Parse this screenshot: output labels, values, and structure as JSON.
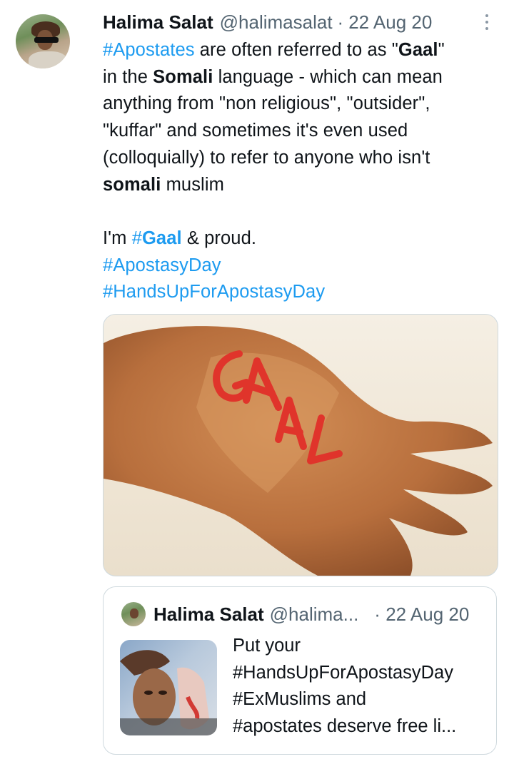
{
  "tweet": {
    "author_name": "Halima Salat",
    "author_handle": "@halimasalat",
    "separator": "·",
    "date": "22 Aug 20",
    "more_icon": "more-vertical-icon",
    "lines": [
      [
        {
          "t": "#Apostates",
          "k": "tag"
        },
        {
          "t": " are often referred to as \"",
          "k": "text"
        },
        {
          "t": "Gaal",
          "k": "bold"
        },
        {
          "t": "\"",
          "k": "text"
        }
      ],
      [
        {
          "t": "in the ",
          "k": "text"
        },
        {
          "t": "Somali",
          "k": "bold"
        },
        {
          "t": " language - which can mean",
          "k": "text"
        }
      ],
      [
        {
          "t": "anything from \"non religious\", \"outsider\",",
          "k": "text"
        }
      ],
      [
        {
          "t": "\"kuffar\" and sometimes it's even used",
          "k": "text"
        }
      ],
      [
        {
          "t": "(colloquially) to refer to anyone who isn't",
          "k": "text"
        }
      ],
      [
        {
          "t": "somali",
          "k": "bold"
        },
        {
          "t": " muslim",
          "k": "text"
        }
      ],
      [],
      [
        {
          "t": "I'm ",
          "k": "text"
        },
        {
          "t": "#",
          "k": "tag"
        },
        {
          "t": "Gaal",
          "k": "tagbold"
        },
        {
          "t": " & proud.",
          "k": "text"
        }
      ],
      [
        {
          "t": "#ApostasyDay",
          "k": "tag"
        }
      ],
      [
        {
          "t": "#HandsUpForApostasyDay",
          "k": "tag"
        }
      ]
    ],
    "media": {
      "description_word": "GAAL",
      "ink_color": "#e0342b"
    }
  },
  "quoted_tweet": {
    "author_name": "Halima Salat",
    "author_handle": "@halima...",
    "separator": "·",
    "date": "22 Aug 20",
    "lines": [
      "Put your",
      "#HandsUpForApostasyDay",
      "#ExMuslims and",
      "#apostates deserve free li..."
    ]
  },
  "colors": {
    "link": "#1d9bf0",
    "secondary_text": "#536471",
    "border": "#cfd9de"
  }
}
